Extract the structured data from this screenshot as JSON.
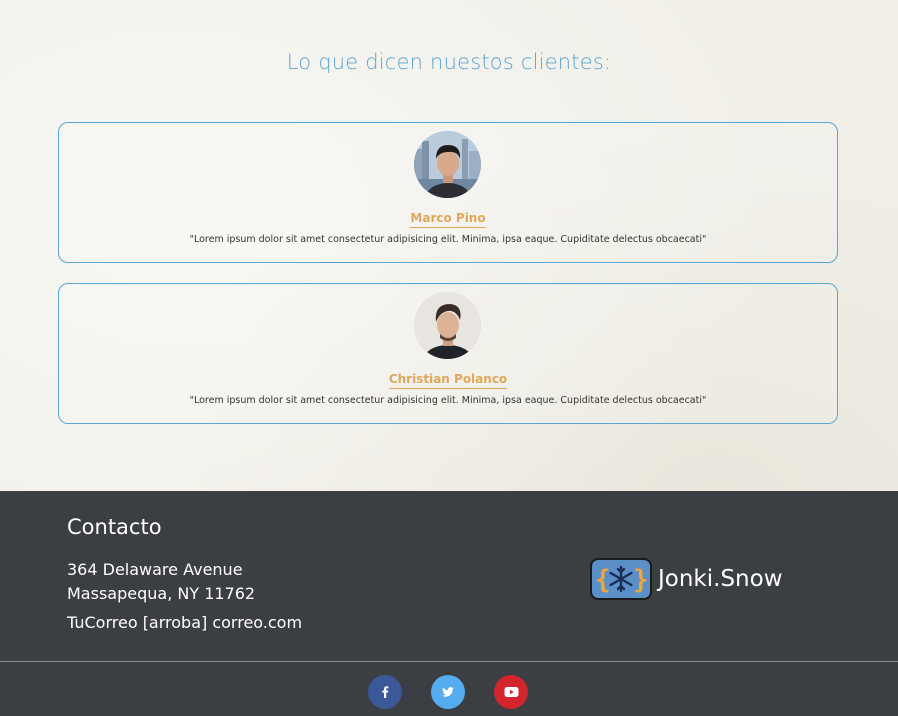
{
  "testimonials": {
    "title": "Lo que dicen nuestos clientes:",
    "items": [
      {
        "name": "Marco Pino",
        "quote": "\"Lorem ipsum dolor sit amet consectetur adipisicing elit. Minima, ipsa eaque. Cupiditate delectus obcaecati\""
      },
      {
        "name": "Christian Polanco",
        "quote": "\"Lorem ipsum dolor sit amet consectetur adipisicing elit. Minima, ipsa eaque. Cupiditate delectus obcaecati\""
      }
    ]
  },
  "footer": {
    "contact_heading": "Contacto",
    "address_line1": "364 Delaware Avenue",
    "address_line2": "Massapequa, NY 11762",
    "email": "TuCorreo [arroba] correo.com",
    "brand_name": "Jonki.Snow",
    "social": [
      {
        "icon": "facebook-icon",
        "color": "#3b5998"
      },
      {
        "icon": "twitter-icon",
        "color": "#55acee"
      },
      {
        "icon": "youtube-icon",
        "color": "#d2262c"
      }
    ]
  },
  "colors": {
    "accent_blue": "#5aa6d4",
    "accent_gold": "#e0a85a",
    "footer_bg": "#3b3e43"
  }
}
